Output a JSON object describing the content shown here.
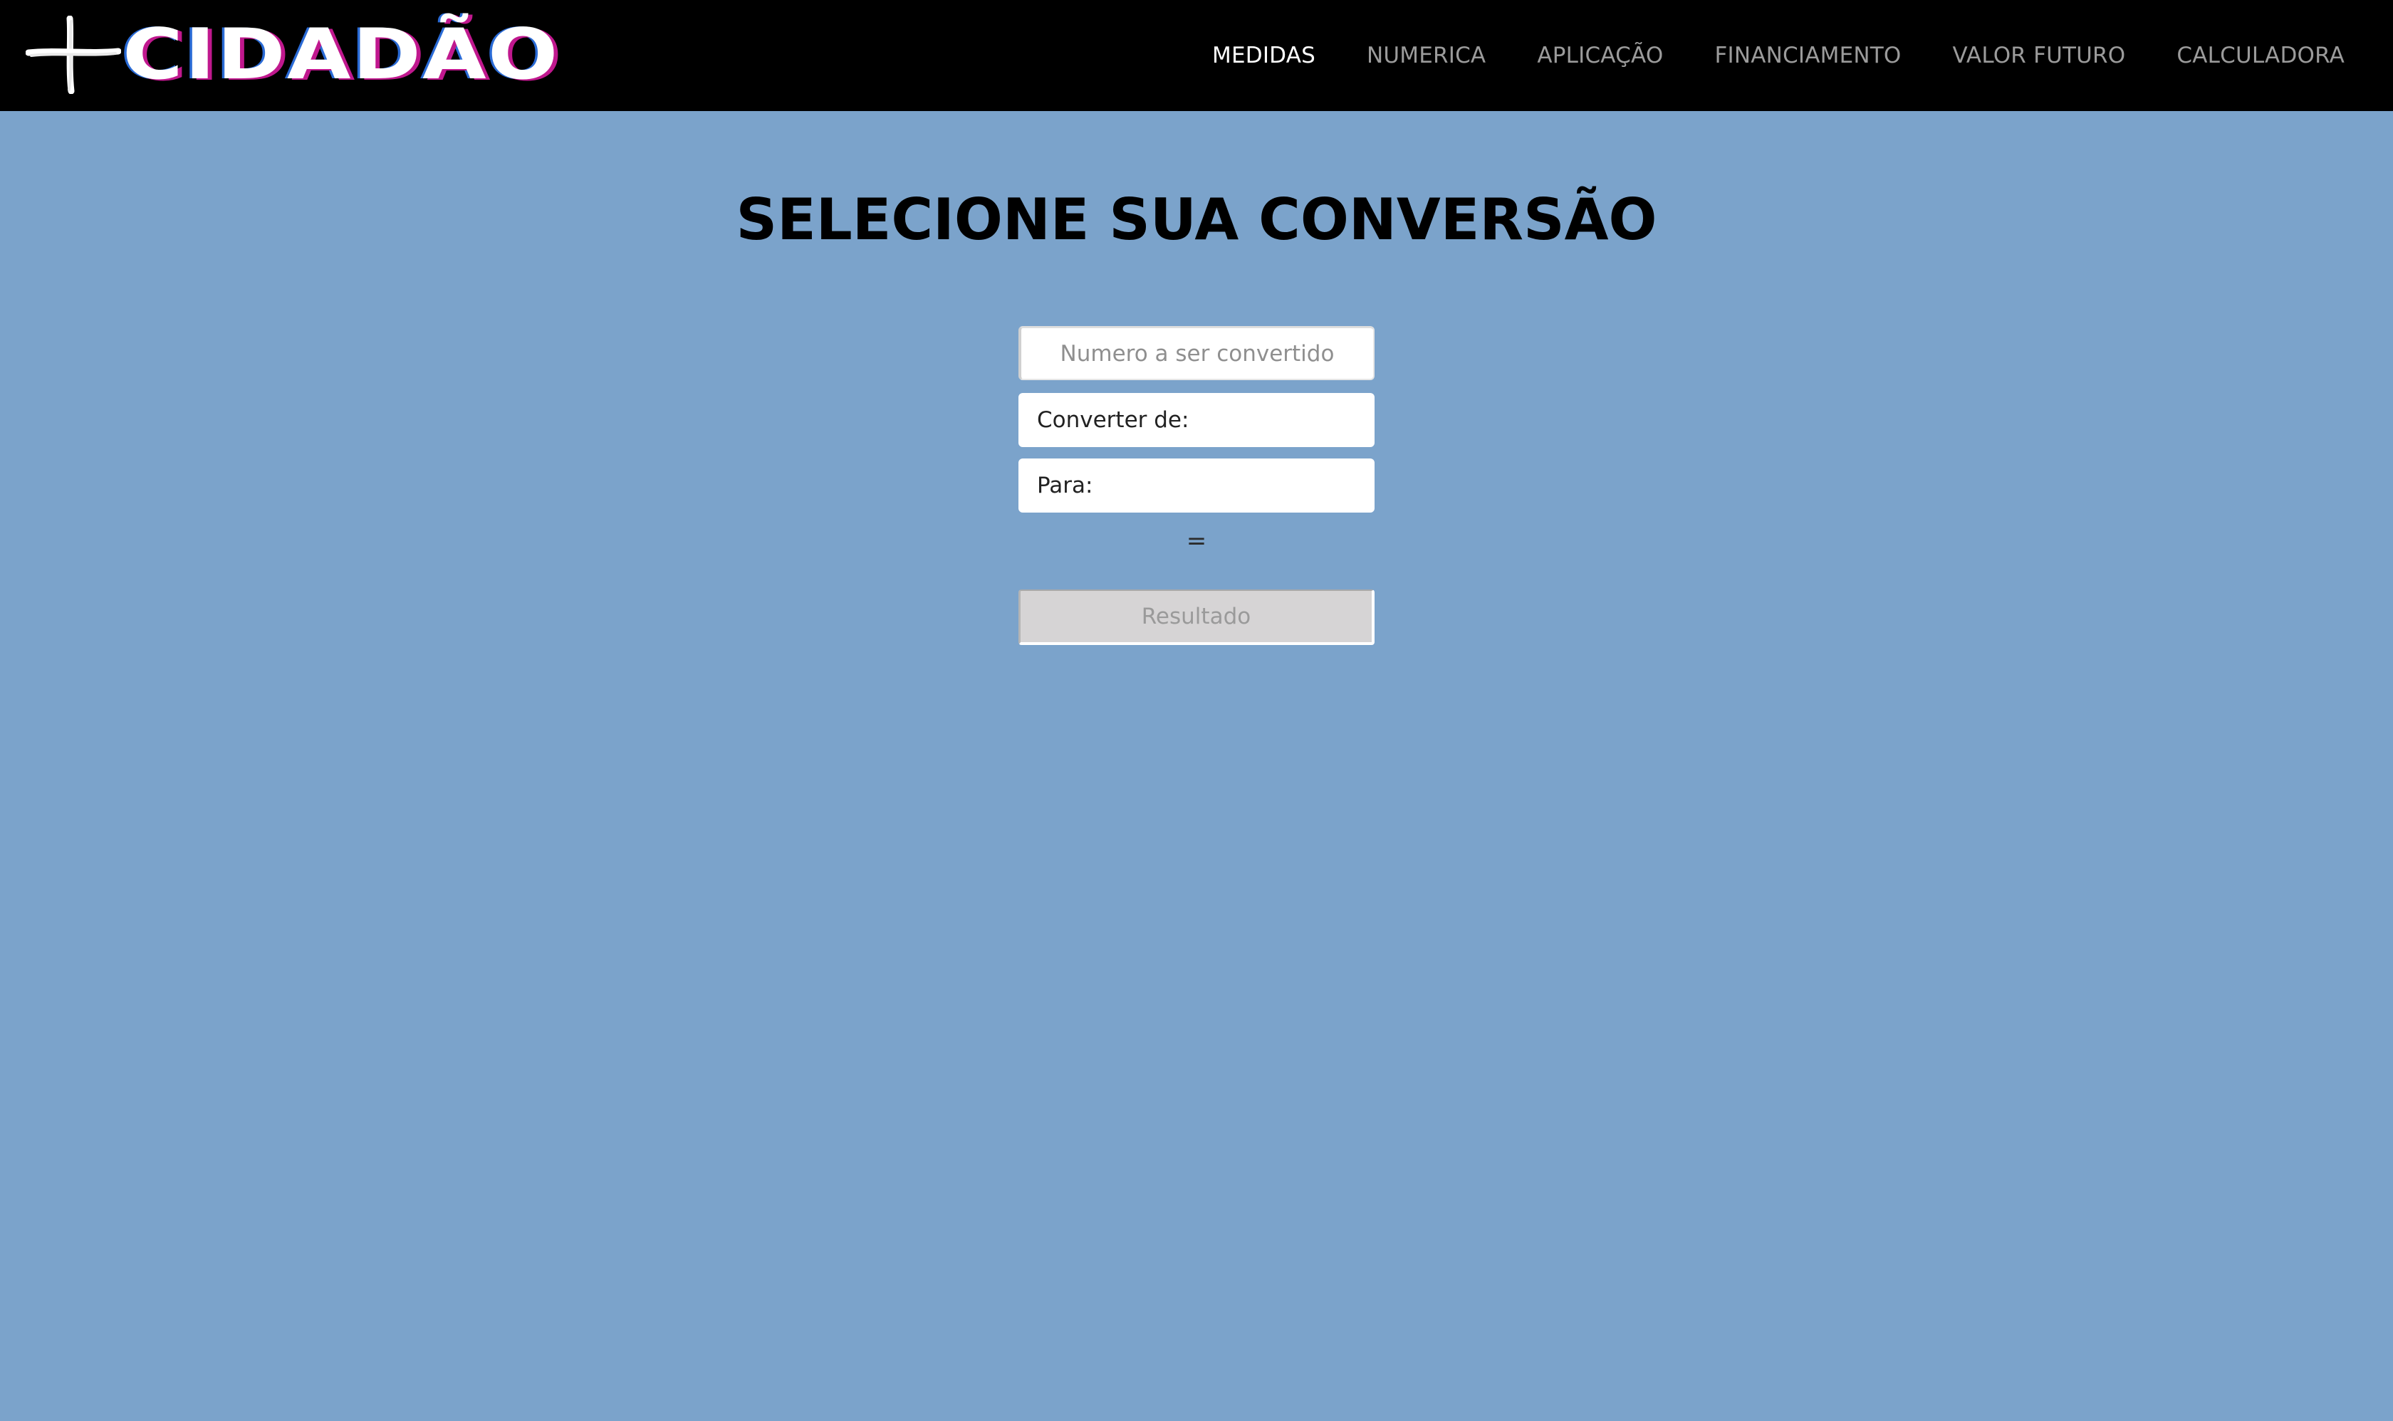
{
  "header": {
    "logo_text": "CIDADÃO",
    "nav": [
      {
        "label": "MEDIDAS",
        "active": true
      },
      {
        "label": "NUMERICA",
        "active": false
      },
      {
        "label": "APLICAÇÃO",
        "active": false
      },
      {
        "label": "FINANCIAMENTO",
        "active": false
      },
      {
        "label": "VALOR FUTURO",
        "active": false
      },
      {
        "label": "CALCULADORA",
        "active": false
      }
    ]
  },
  "main": {
    "title": "SELECIONE SUA CONVERSÃO",
    "number_input": {
      "placeholder": "Numero a ser convertido",
      "value": ""
    },
    "convert_from": {
      "label": "Converter de:"
    },
    "convert_to": {
      "label": "Para:"
    },
    "equals": "=",
    "result": {
      "placeholder": "Resultado",
      "value": ""
    }
  },
  "colors": {
    "background": "#7ba3cb",
    "header_background": "#000000",
    "nav_active": "#ffffff",
    "nav_inactive": "#9b9b9b",
    "result_background": "#d6d4d5"
  },
  "icons": [
    "cross-icon"
  ]
}
